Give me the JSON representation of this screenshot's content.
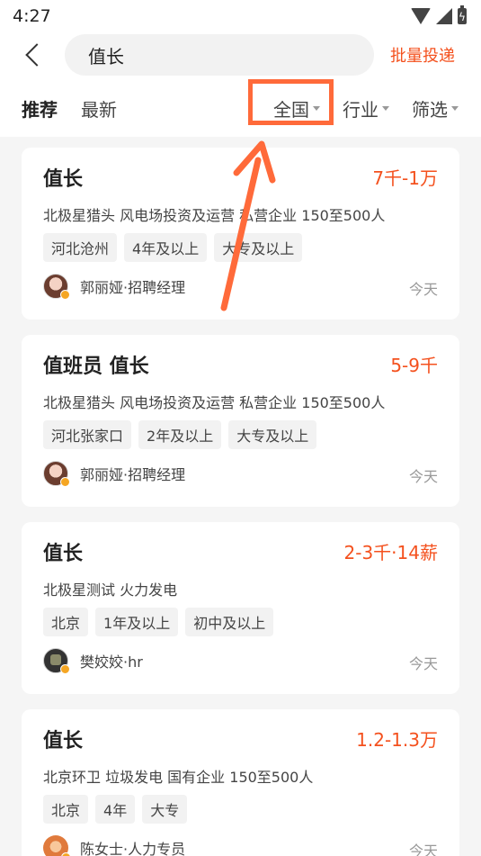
{
  "status_bar": {
    "time": "4:27"
  },
  "header": {
    "search_value": "值长",
    "batch_label": "批量投递"
  },
  "tabs": {
    "recommended": "推荐",
    "latest": "最新",
    "city": "全国",
    "industry": "行业",
    "filter": "筛选"
  },
  "colors": {
    "accent": "#f4511e",
    "highlight": "#ff6a3a"
  },
  "jobs": [
    {
      "title": "值长",
      "salary": "7千-1万",
      "company": "北极星猎头 风电场投资及运营 私营企业 150至500人",
      "tags": [
        "河北沧州",
        "4年及以上",
        "大专及以上"
      ],
      "recruiter": "郭丽娅·招聘经理",
      "time": "今天"
    },
    {
      "title": "值班员 值长",
      "salary": "5-9千",
      "company": "北极星猎头 风电场投资及运营 私营企业 150至500人",
      "tags": [
        "河北张家口",
        "2年及以上",
        "大专及以上"
      ],
      "recruiter": "郭丽娅·招聘经理",
      "time": "今天"
    },
    {
      "title": "值长",
      "salary": "2-3千·14薪",
      "company": "北极星测试 火力发电",
      "tags": [
        "北京",
        "1年及以上",
        "初中及以上"
      ],
      "recruiter": "樊姣姣·hr",
      "time": "今天"
    },
    {
      "title": "值长",
      "salary": "1.2-1.3万",
      "company": "北京环卫 垃圾发电 国有企业 150至500人",
      "tags": [
        "北京",
        "4年",
        "大专"
      ],
      "recruiter": "陈女士·人力专员",
      "time": "今天"
    }
  ]
}
